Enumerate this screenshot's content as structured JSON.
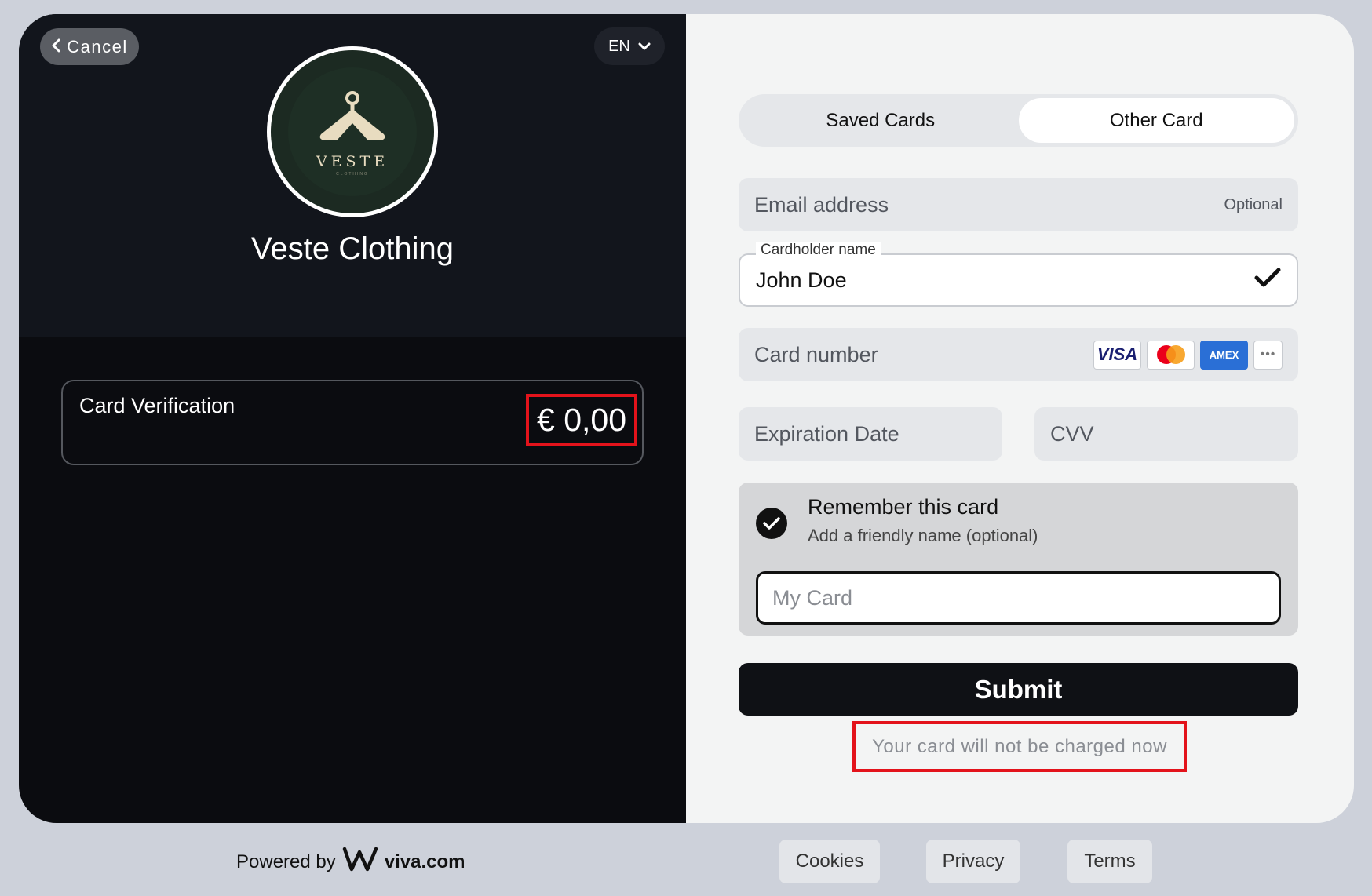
{
  "header": {
    "cancel_label": "Cancel",
    "language": "EN"
  },
  "merchant": {
    "logo_word": "VESTE",
    "logo_sub": "CLOTHING",
    "name": "Veste Clothing"
  },
  "summary": {
    "label": "Card Verification",
    "amount": "€ 0,00"
  },
  "tabs": [
    {
      "label": "Saved Cards",
      "active": false
    },
    {
      "label": "Other Card",
      "active": true
    }
  ],
  "form": {
    "email": {
      "placeholder": "Email address",
      "optional": "Optional"
    },
    "cardholder": {
      "label": "Cardholder name",
      "value": "John Doe"
    },
    "card_number": {
      "placeholder": "Card number",
      "brands": [
        "VISA",
        "mastercard",
        "AMEX",
        "more"
      ]
    },
    "expiration": {
      "placeholder": "Expiration Date"
    },
    "cvv": {
      "placeholder": "CVV"
    },
    "remember": {
      "title": "Remember this card",
      "subtitle": "Add a friendly name (optional)",
      "placeholder": "My Card"
    },
    "submit_label": "Submit",
    "note": "Your card will not be charged now"
  },
  "footer": {
    "powered_by": "Powered by",
    "brand": "viva.com",
    "links": [
      "Cookies",
      "Privacy",
      "Terms"
    ]
  }
}
